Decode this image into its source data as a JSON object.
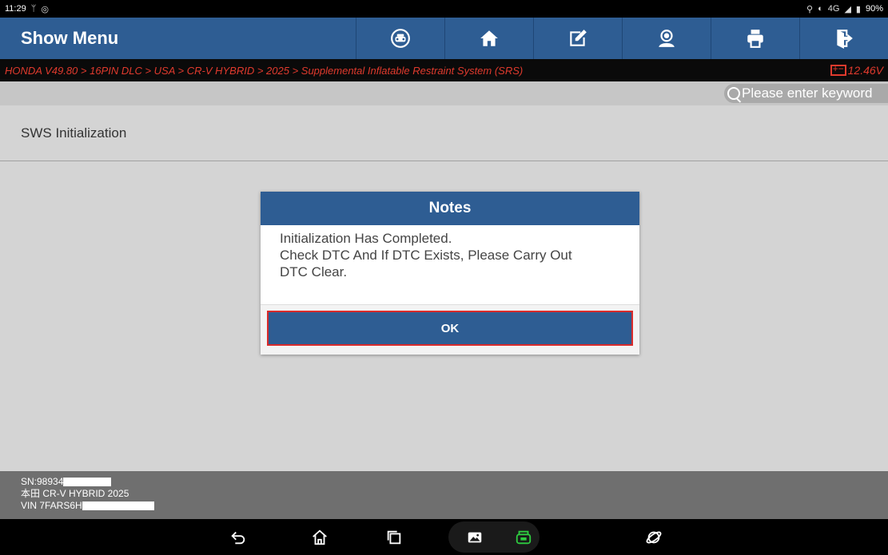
{
  "status_bar": {
    "time": "11:29",
    "battery": "90%",
    "network": "4G"
  },
  "header": {
    "title": "Show Menu",
    "buttons": [
      "vehicle-icon",
      "home-icon",
      "edit-icon",
      "support-icon",
      "print-icon",
      "exit-icon"
    ]
  },
  "breadcrumb": {
    "path": "HONDA V49.80 > 16PIN DLC > USA > CR-V HYBRID > 2025 > Supplemental Inflatable Restraint System (SRS)",
    "voltage": "12.46V"
  },
  "search": {
    "placeholder": "Please enter keyword"
  },
  "menu": {
    "items": [
      {
        "label": "SWS Initialization"
      }
    ]
  },
  "dialog": {
    "title": "Notes",
    "lines": [
      "Initialization Has Completed.",
      "Check DTC And If DTC Exists, Please Carry Out",
      "DTC Clear."
    ],
    "ok_label": "OK"
  },
  "vehicle_info": {
    "sn": "SN:98934",
    "model": "本田 CR-V HYBRID 2025",
    "vin": "VIN 7FARS6H"
  },
  "colors": {
    "accent": "#2e5d93",
    "breadcrumb": "#e03a2d",
    "highlight": "#d92b2b",
    "vci_icon": "#2ecc40"
  }
}
